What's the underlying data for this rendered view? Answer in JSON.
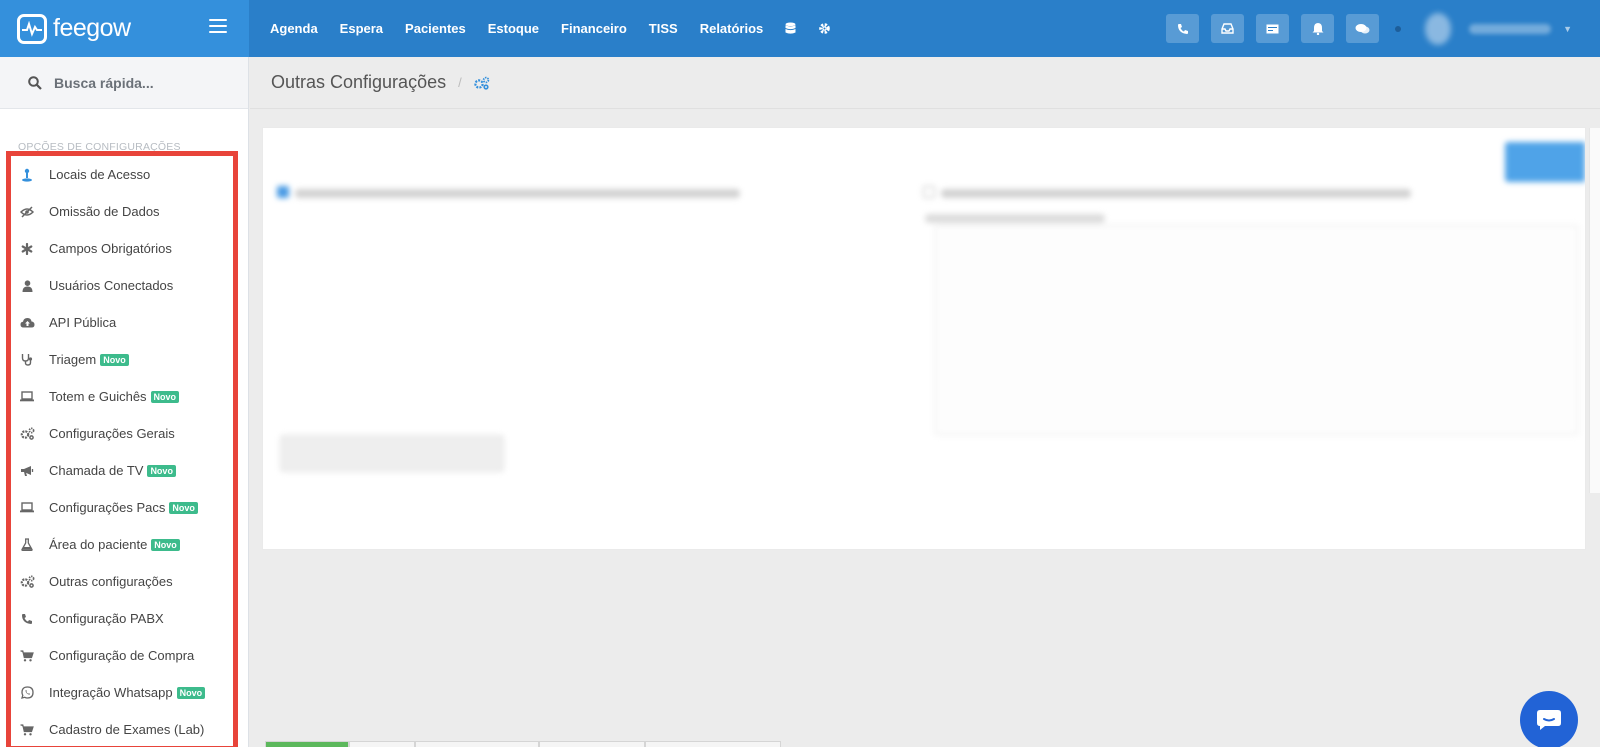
{
  "brand": {
    "name": "feegow"
  },
  "topnav": {
    "items": [
      "Agenda",
      "Espera",
      "Pacientes",
      "Estoque",
      "Financeiro",
      "TISS",
      "Relatórios"
    ],
    "icons": [
      "database-icon",
      "gear-icon"
    ]
  },
  "toolbar": {
    "buttons": [
      "phone-icon",
      "inbox-icon",
      "card-icon",
      "bell-icon",
      "chat-icon"
    ]
  },
  "search": {
    "placeholder": "Busca rápida..."
  },
  "sidebar": {
    "section_title": "OPÇÕES DE CONFIGURAÇÕES",
    "badge_label": "Novo",
    "items": [
      {
        "label": "Locais de Acesso",
        "icon": "location-pin-icon",
        "badge": false
      },
      {
        "label": "Omissão de Dados",
        "icon": "eye-slash-icon",
        "badge": false
      },
      {
        "label": "Campos Obrigatórios",
        "icon": "asterisk-icon",
        "badge": false
      },
      {
        "label": "Usuários Conectados",
        "icon": "user-icon",
        "badge": false
      },
      {
        "label": "API Pública",
        "icon": "cloud-upload-icon",
        "badge": false
      },
      {
        "label": "Triagem",
        "icon": "stethoscope-icon",
        "badge": true
      },
      {
        "label": "Totem e Guichês",
        "icon": "laptop-icon",
        "badge": true
      },
      {
        "label": "Configurações Gerais",
        "icon": "gears-icon",
        "badge": false
      },
      {
        "label": "Chamada de TV",
        "icon": "megaphone-icon",
        "badge": true
      },
      {
        "label": "Configurações Pacs",
        "icon": "laptop-icon",
        "badge": true
      },
      {
        "label": "Área do paciente",
        "icon": "flask-icon",
        "badge": true
      },
      {
        "label": "Outras configurações",
        "icon": "gears-icon",
        "badge": false
      },
      {
        "label": "Configuração PABX",
        "icon": "phone-icon",
        "badge": false
      },
      {
        "label": "Configuração de Compra",
        "icon": "cart-icon",
        "badge": false
      },
      {
        "label": "Integração Whatsapp",
        "icon": "whatsapp-icon",
        "badge": true
      },
      {
        "label": "Cadastro de Exames (Lab)",
        "icon": "cart-icon",
        "badge": false
      }
    ]
  },
  "main": {
    "title": "Outras Configurações",
    "breadcrumb_sep": "/"
  },
  "colors": {
    "topbar": "#2a7fc9",
    "brand_bg": "#3490dc",
    "highlight_border": "#e8443a",
    "badge": "#3dbb8c",
    "chat_fab": "#2263d6"
  }
}
